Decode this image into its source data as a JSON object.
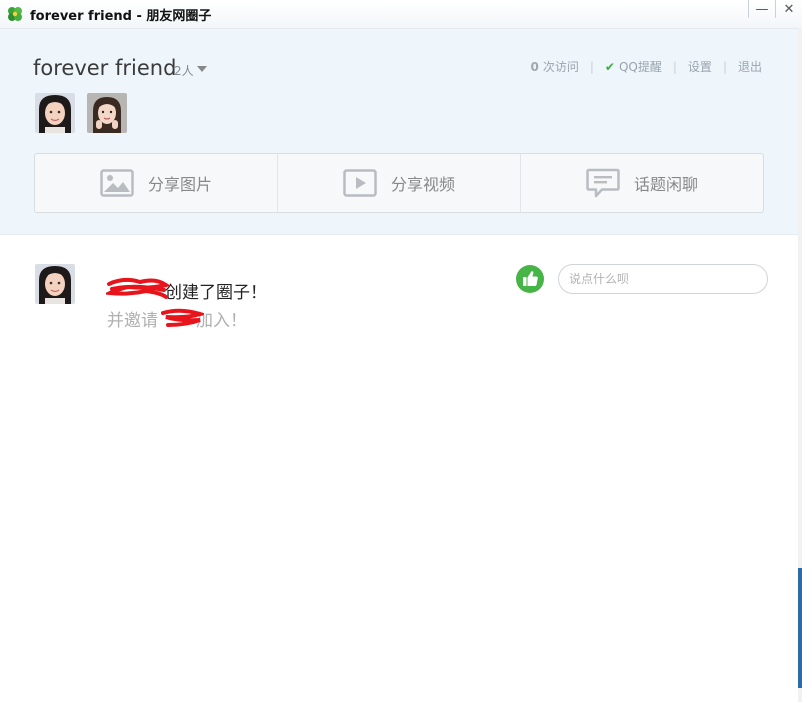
{
  "window": {
    "title": "forever friend - 朋友网圈子",
    "minimize_glyph": "—",
    "close_glyph": "✕"
  },
  "circle": {
    "name": "forever friend",
    "member_count": "2人"
  },
  "top_links": {
    "visits_number": "0",
    "visits_label": "次访问",
    "qq_reminder": "QQ提醒",
    "settings": "设置",
    "exit": "退出"
  },
  "share_actions": [
    {
      "label": "分享图片",
      "icon": "image-icon"
    },
    {
      "label": "分享视频",
      "icon": "video-icon"
    },
    {
      "label": "话题闲聊",
      "icon": "chat-icon"
    }
  ],
  "feed": {
    "post": {
      "line1_suffix": "创建了圈子！",
      "line2_prefix": "并邀请",
      "line2_suffix": "加入！"
    },
    "comment_placeholder": "说点什么呗"
  },
  "colors": {
    "accent_green": "#47b447",
    "header_bg": "#eef6fc",
    "redaction_red": "#e8141c"
  }
}
